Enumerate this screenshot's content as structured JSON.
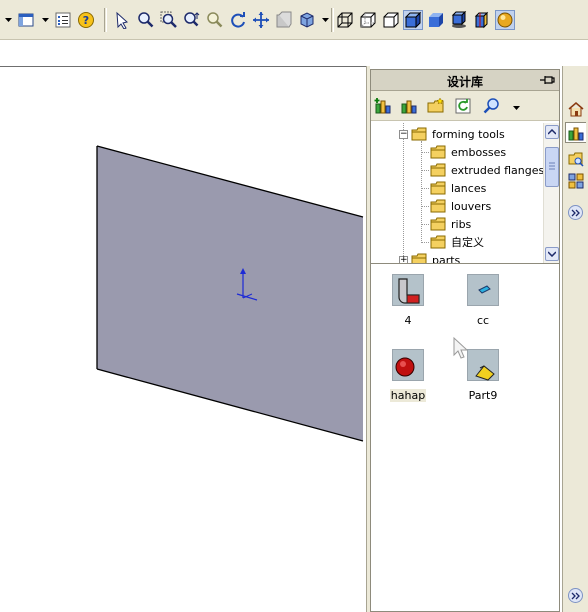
{
  "panel": {
    "title": "设计库"
  },
  "tree": {
    "items": [
      {
        "label": "forming tools",
        "expander": "−"
      },
      {
        "label": "embosses"
      },
      {
        "label": "extruded flanges"
      },
      {
        "label": "lances"
      },
      {
        "label": "louvers"
      },
      {
        "label": "ribs"
      },
      {
        "label": "自定义"
      },
      {
        "label": "parts",
        "expander": "+"
      }
    ]
  },
  "files": [
    {
      "label": "4",
      "icon": "bent-part-icon"
    },
    {
      "label": "cc",
      "icon": "small-part-icon"
    },
    {
      "label": "hahap",
      "icon": "red-sphere-part-icon",
      "selected": true
    },
    {
      "label": "Part9",
      "icon": "yellow-part-icon"
    }
  ],
  "colors": {
    "toolbar_bg": "#ece9d8",
    "plane_fill": "#9a9aae",
    "axis_blue": "#1d2ad6"
  },
  "toolbar": {
    "icons": [
      "dropdown-arrow-icon",
      "view-panel-icon",
      "dropdown-arrow-icon",
      "properties-icon",
      "help-icon",
      "select-icon",
      "zoom-to-fit-icon",
      "zoom-area-icon",
      "zoom-in-out-icon",
      "zoom-to-selection-icon",
      "rotate-icon",
      "pan-icon",
      "3d-drawing-view-icon",
      "standard-views-icon",
      "dropdown-arrow-icon",
      "wireframe-icon",
      "hidden-lines-visible-icon",
      "hidden-lines-removed-icon",
      "shaded-with-edges-icon",
      "shaded-icon",
      "shadows-icon",
      "section-view-icon",
      "realview-icon"
    ]
  }
}
